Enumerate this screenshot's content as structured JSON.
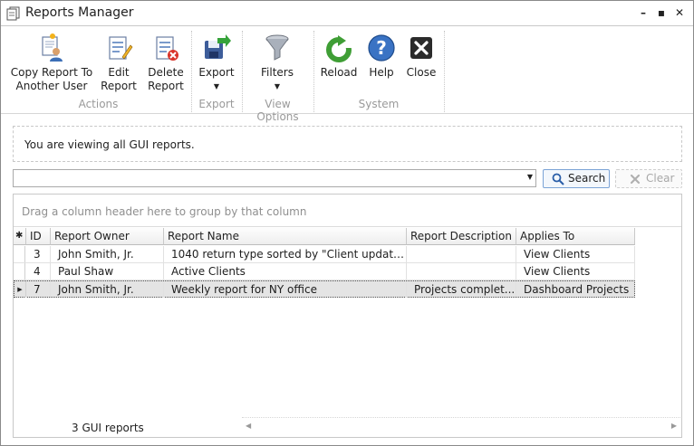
{
  "window": {
    "title": "Reports Manager",
    "minimize": "–",
    "maximize": "▪",
    "close": "✕"
  },
  "ribbon": {
    "groups": [
      {
        "label": "Actions"
      },
      {
        "label": "Export"
      },
      {
        "label": "View Options"
      },
      {
        "label": "System"
      }
    ],
    "buttons": {
      "copy_report": {
        "label": "Copy Report To\nAnother User",
        "icon": "copy-report-user-icon"
      },
      "edit_report": {
        "label": "Edit\nReport",
        "icon": "edit-report-icon"
      },
      "delete_report": {
        "label": "Delete\nReport",
        "icon": "delete-report-icon"
      },
      "export": {
        "label": "Export",
        "icon": "export-icon",
        "arrow": "▼"
      },
      "filters": {
        "label": "Filters",
        "icon": "funnel-icon",
        "arrow": "▼"
      },
      "reload": {
        "label": "Reload",
        "icon": "reload-icon"
      },
      "help": {
        "label": "Help",
        "icon": "help-icon"
      },
      "close": {
        "label": "Close",
        "icon": "close-icon"
      }
    }
  },
  "info": {
    "text": "You are viewing all GUI reports."
  },
  "search": {
    "value": "",
    "search_label": "Search",
    "clear_label": "Clear"
  },
  "grid": {
    "group_hint": "Drag a column header here to group by that column",
    "columns": [
      "ID",
      "Report Owner",
      "Report Name",
      "Report Description",
      "Applies To"
    ],
    "rows": [
      {
        "id": "3",
        "owner": "John Smith, Jr.",
        "name": "1040 return type sorted by \"Client updated...",
        "description": "",
        "applies_to": "View Clients"
      },
      {
        "id": "4",
        "owner": "Paul Shaw",
        "name": "Active Clients",
        "description": "",
        "applies_to": "View Clients"
      },
      {
        "id": "7",
        "owner": "John Smith, Jr.",
        "name": "Weekly report for NY office",
        "description": "Projects complet...",
        "applies_to": "Dashboard Projects"
      }
    ],
    "footer_count": "3 GUI reports"
  },
  "colors": {
    "accent": "#2a6ebb",
    "selected_row": "#e4e4e4",
    "muted_text": "#9a9a9a"
  }
}
